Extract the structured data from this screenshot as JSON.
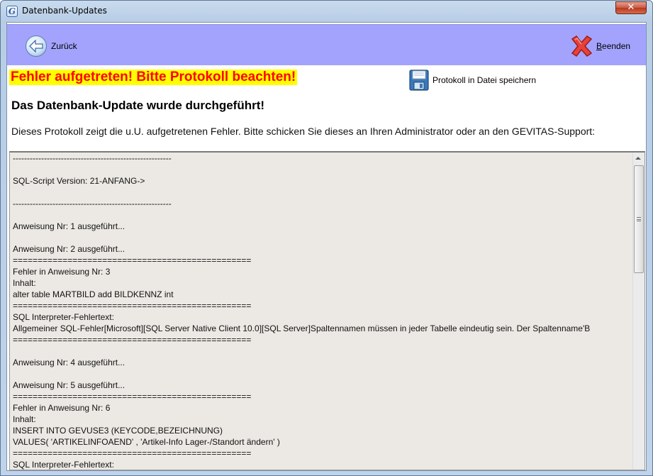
{
  "window": {
    "title": "Datenbank-Updates",
    "close_glyph": "✕"
  },
  "toolbar": {
    "back_label": "Zurück",
    "quit_label_prefix": "B",
    "quit_label_rest": "eenden"
  },
  "status": {
    "error_banner": "Fehler aufgetreten! Bitte Protokoll beachten!",
    "save_log_label": "Protokoll in Datei speichern",
    "heading": "Das Datenbank-Update wurde durchgeführt!",
    "intro": "Dieses Protokoll zeigt die u.U. aufgetretenen Fehler. Bitte schicken Sie dieses an Ihren Administrator oder an den GEVITAS-Support:"
  },
  "log": {
    "lines": [
      "--------------------------------------------------------",
      "",
      "SQL-Script Version: 21-ANFANG->",
      "",
      "--------------------------------------------------------",
      "",
      "Anweisung Nr: 1 ausgeführt...",
      "",
      "Anweisung Nr: 2 ausgeführt...",
      "================================================",
      "Fehler in Anweisung Nr: 3",
      "Inhalt:",
      "alter table MARTBILD add BILDKENNZ int",
      "================================================",
      "SQL Interpreter-Fehlertext:",
      "Allgemeiner SQL-Fehler[Microsoft][SQL Server Native Client 10.0][SQL Server]Spaltennamen müssen in jeder Tabelle eindeutig sein. Der Spaltenname'B",
      "================================================",
      "",
      "Anweisung Nr: 4 ausgeführt...",
      "",
      "Anweisung Nr: 5 ausgeführt...",
      "================================================",
      "Fehler in Anweisung Nr: 6",
      "Inhalt:",
      "INSERT INTO GEVUSE3 (KEYCODE,BEZEICHNUNG)",
      "VALUES( 'ARTIKELINFOAEND' , 'Artikel-Info Lager-/Standort ändern' )",
      "================================================",
      "SQL Interpreter-Fehlertext:"
    ]
  },
  "colors": {
    "toolbar_bg": "#a3a3fe",
    "error_text": "#ff0000",
    "error_bg": "#ffff00",
    "log_bg": "#ece9e4"
  },
  "icons": [
    "app-icon",
    "back-arrow-icon",
    "red-x-icon",
    "floppy-disk-icon",
    "close-icon"
  ]
}
